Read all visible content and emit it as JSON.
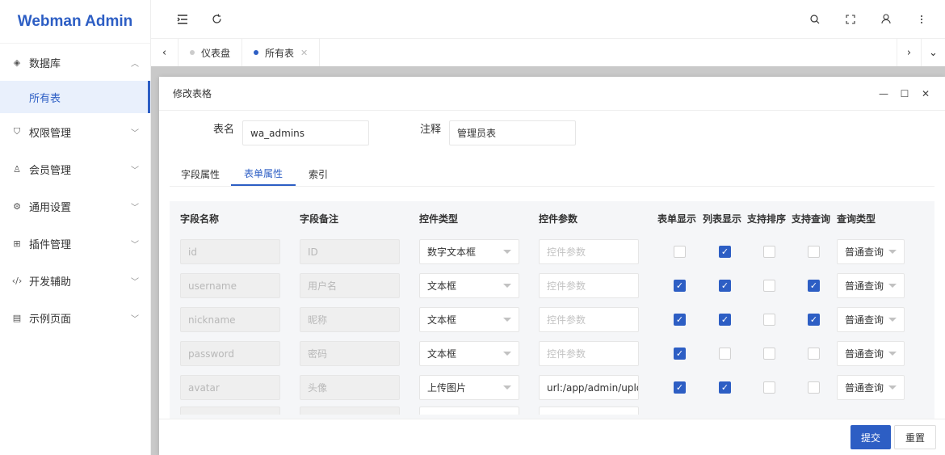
{
  "app": {
    "title": "Webman Admin",
    "accent": "#2d5ec4"
  },
  "sidebar": {
    "items": [
      {
        "label": "数据库",
        "icon": "layers-icon",
        "expanded": true
      },
      {
        "label": "权限管理",
        "icon": "shield-icon"
      },
      {
        "label": "会员管理",
        "icon": "user-icon"
      },
      {
        "label": "通用设置",
        "icon": "gear-icon"
      },
      {
        "label": "插件管理",
        "icon": "plugin-icon"
      },
      {
        "label": "开发辅助",
        "icon": "code-icon"
      },
      {
        "label": "示例页面",
        "icon": "page-icon"
      }
    ],
    "sub_active": "所有表"
  },
  "tabs": [
    {
      "label": "仪表盘",
      "active": false
    },
    {
      "label": "所有表",
      "active": true
    }
  ],
  "modal": {
    "title": "修改表格",
    "table_name_label": "表名",
    "table_name_value": "wa_admins",
    "comment_label": "注释",
    "comment_value": "管理员表",
    "sub_tabs": [
      "字段属性",
      "表单属性",
      "索引"
    ],
    "active_sub_tab": "表单属性",
    "columns": [
      "字段名称",
      "字段备注",
      "控件类型",
      "控件参数",
      "表单显示",
      "列表显示",
      "支持排序",
      "支持查询",
      "查询类型"
    ],
    "rows": [
      {
        "name": "id",
        "comment": "ID",
        "control": "数字文本框",
        "param": "",
        "form": false,
        "list": true,
        "sort": false,
        "query": false,
        "query_type": "普通查询"
      },
      {
        "name": "username",
        "comment": "用户名",
        "control": "文本框",
        "param": "",
        "form": true,
        "list": true,
        "sort": false,
        "query": true,
        "query_type": "普通查询"
      },
      {
        "name": "nickname",
        "comment": "昵称",
        "control": "文本框",
        "param": "",
        "form": true,
        "list": true,
        "sort": false,
        "query": true,
        "query_type": "普通查询"
      },
      {
        "name": "password",
        "comment": "密码",
        "control": "文本框",
        "param": "",
        "form": true,
        "list": false,
        "sort": false,
        "query": false,
        "query_type": "普通查询"
      },
      {
        "name": "avatar",
        "comment": "头像",
        "control": "上传图片",
        "param": "url:/app/admin/upload",
        "form": true,
        "list": true,
        "sort": false,
        "query": false,
        "query_type": "普通查询"
      }
    ],
    "param_placeholder": "控件参数",
    "submit_label": "提交",
    "reset_label": "重置"
  }
}
